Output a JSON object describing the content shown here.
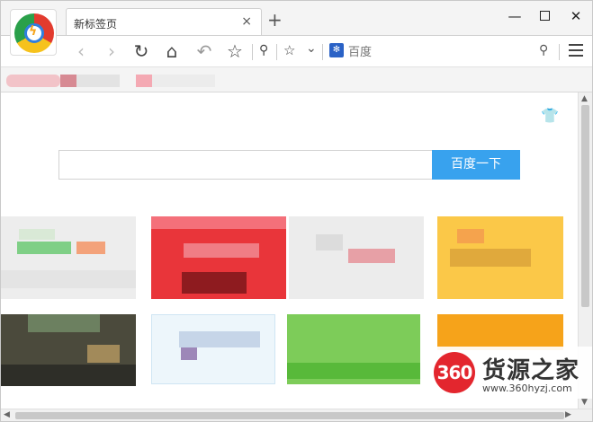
{
  "titlebar": {
    "tab_title": "新标签页",
    "tab_close": "×",
    "new_tab": "+",
    "min": "—",
    "close": "✕"
  },
  "toolbar": {
    "back": "‹",
    "forward": "›",
    "reload": "↻",
    "home": "⌂",
    "undo": "↶",
    "star": "☆",
    "mini_search": "⚲",
    "mini_star": "☆",
    "mini_down": "⌄",
    "engine_icon": "✻",
    "address_placeholder": "百度",
    "addr_search": "⚲"
  },
  "page": {
    "skin_icon": "👕",
    "search_button": "百度一下"
  },
  "scroll": {
    "up": "▲",
    "down": "▼",
    "left": "◀",
    "right": "▶"
  },
  "watermark": {
    "logo": "360",
    "brand": "货源之家",
    "url": "www.360hyzj.com"
  },
  "colors": {
    "accent": "#38a2ee",
    "brand_red": "#e3262e"
  }
}
